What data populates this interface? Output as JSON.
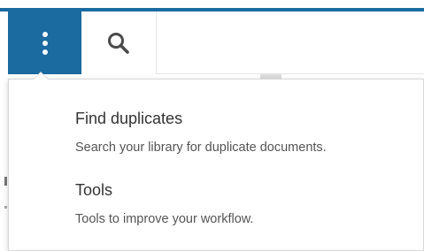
{
  "toolbar": {
    "menu_icon": "more-vertical-icon",
    "search_icon": "search-icon",
    "accent_color": "#1b6aa0"
  },
  "dropdown": {
    "items": [
      {
        "title": "Find duplicates",
        "description": "Search your library for duplicate documents."
      },
      {
        "title": "Tools",
        "description": "Tools to improve your workflow."
      }
    ]
  }
}
